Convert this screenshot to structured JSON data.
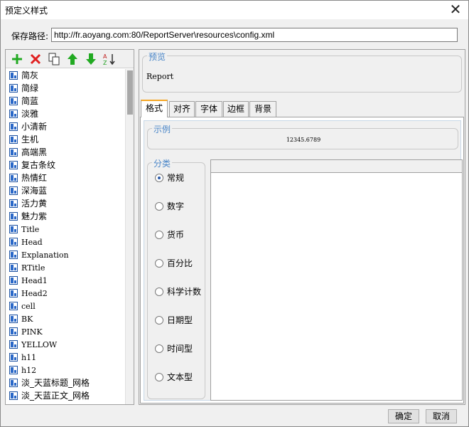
{
  "window": {
    "title": "预定义样式"
  },
  "path": {
    "label": "保存路径:",
    "value": "http://fr.aoyang.com:80/ReportServer\\resources\\config.xml"
  },
  "toolbar": {
    "add": {
      "icon": "add-icon",
      "color": "#22aa22"
    },
    "delete": {
      "icon": "delete-icon",
      "color": "#e02020"
    },
    "copy": {
      "icon": "copy-icon"
    },
    "move_up": {
      "icon": "arrow-up-icon",
      "color": "#22aa22"
    },
    "move_down": {
      "icon": "arrow-down-icon",
      "color": "#22aa22"
    },
    "sort": {
      "icon": "sort-az-icon"
    }
  },
  "style_list": [
    "简灰",
    "简绿",
    "简蓝",
    "淡雅",
    "小清新",
    "生机",
    "高端黑",
    "复古条纹",
    "热情红",
    "深海蓝",
    "活力黄",
    "魅力紫",
    "Title",
    "Head",
    "Explanation",
    "RTitle",
    "Head1",
    "Head2",
    "cell",
    "BK",
    "PINK",
    "YELLOW",
    "h11",
    "h12",
    "淡_天蓝标题_网格",
    "淡_天蓝正文_网格"
  ],
  "preview": {
    "legend": "预览",
    "text": "Report"
  },
  "tabs": [
    "格式",
    "对齐",
    "字体",
    "边框",
    "背景"
  ],
  "example": {
    "legend": "示例",
    "value": "12345.6789"
  },
  "category": {
    "legend": "分类",
    "options": [
      "常规",
      "数字",
      "货币",
      "百分比",
      "科学计数",
      "日期型",
      "时间型",
      "文本型"
    ],
    "selected": "常规"
  },
  "buttons": {
    "ok": "确定",
    "cancel": "取消"
  },
  "colors": {
    "accent": "#4a86c8",
    "active_tab": "#f5a623"
  }
}
